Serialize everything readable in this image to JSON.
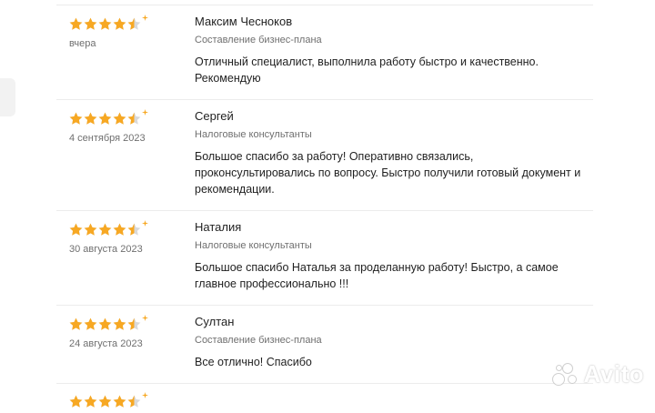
{
  "reviews": [
    {
      "rating": 4.5,
      "date": "вчера",
      "name": "Максим Чесноков",
      "service": "Составление бизнес-плана",
      "text": "Отличный специалист, выполнила работу быстро и качественно. Рекомендую"
    },
    {
      "rating": 4.5,
      "date": "4 сентября 2023",
      "name": "Сергей",
      "service": "Налоговые консультанты",
      "text": "Большое спасибо за работу! Оперативно связались, проконсультировались по вопросу. Быстро получили готовый документ и рекомендации."
    },
    {
      "rating": 4.5,
      "date": "30 августа 2023",
      "name": "Наталия",
      "service": "Налоговые консультанты",
      "text": "Большое спасибо Наталья за проделанную работу! Быстро, а самое главное профессионально !!!"
    },
    {
      "rating": 4.5,
      "date": "24 августа 2023",
      "name": "Султан",
      "service": "Составление бизнес-плана",
      "text": "Все отлично! Спасибо"
    }
  ],
  "watermark": {
    "text": "Avito"
  },
  "colors": {
    "star": "#f7a823",
    "star_empty": "#d9d9d9",
    "muted": "#6f6f6f",
    "divider": "#ececec"
  },
  "icons": {
    "star": "star-icon",
    "half_star": "half-star-icon",
    "sparkle": "sparkle-icon",
    "logo": "avito-logo-icon"
  }
}
